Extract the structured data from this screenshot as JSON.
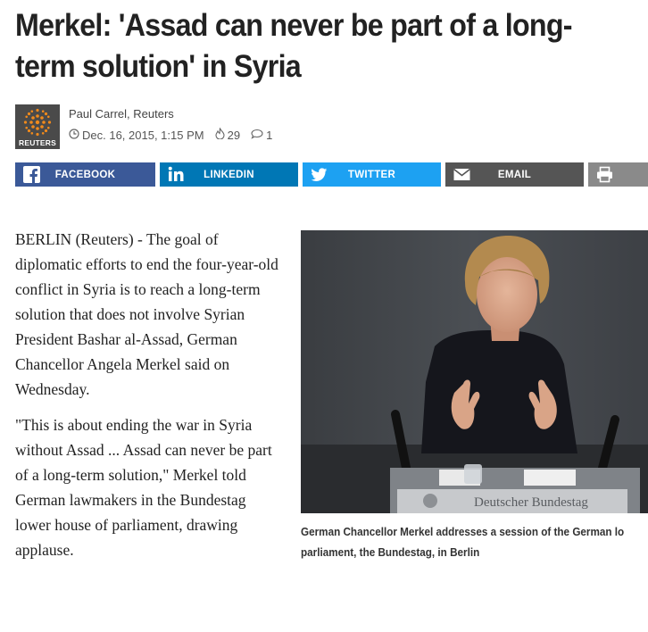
{
  "article": {
    "headline": "Merkel: 'Assad can never be part of a long-term solution' in Syria",
    "author": "Paul Carrel, Reuters",
    "date": "Dec. 16, 2015, 1:15 PM",
    "likes": "29",
    "comments": "1",
    "source_logo_text": "REUTERS"
  },
  "share": {
    "facebook": "FACEBOOK",
    "linkedin": "LINKEDIN",
    "twitter": "TWITTER",
    "email": "EMAIL"
  },
  "body": {
    "paragraphs": [
      "BERLIN (Reuters) - The goal of diplomatic efforts to end the four-year-old conflict in Syria is to reach a long-term solution that does not involve Syrian President Bashar al-Assad, German Chancellor Angela Merkel said on Wednesday.",
      "\"This is about ending the war in Syria without Assad ... Assad can never be part of a long-term solution,\" Merkel told German lawmakers in the Bundestag lower house of parliament, drawing applause."
    ]
  },
  "photo": {
    "sign_text": "Deutscher Bundestag",
    "caption_line1": "German Chancellor Merkel addresses a session of the German lo",
    "caption_line2": "parliament, the Bundestag, in Berlin"
  },
  "icons": {
    "clock": "clock-icon",
    "like": "flame-icon",
    "comment": "comment-icon",
    "facebook": "facebook-icon",
    "linkedin": "linkedin-icon",
    "twitter": "twitter-icon",
    "email": "envelope-icon",
    "print": "printer-icon"
  },
  "colors": {
    "facebook": "#3b5998",
    "linkedin": "#0077b5",
    "twitter": "#1da1f2",
    "email": "#555555",
    "print": "#8a8a8a"
  }
}
